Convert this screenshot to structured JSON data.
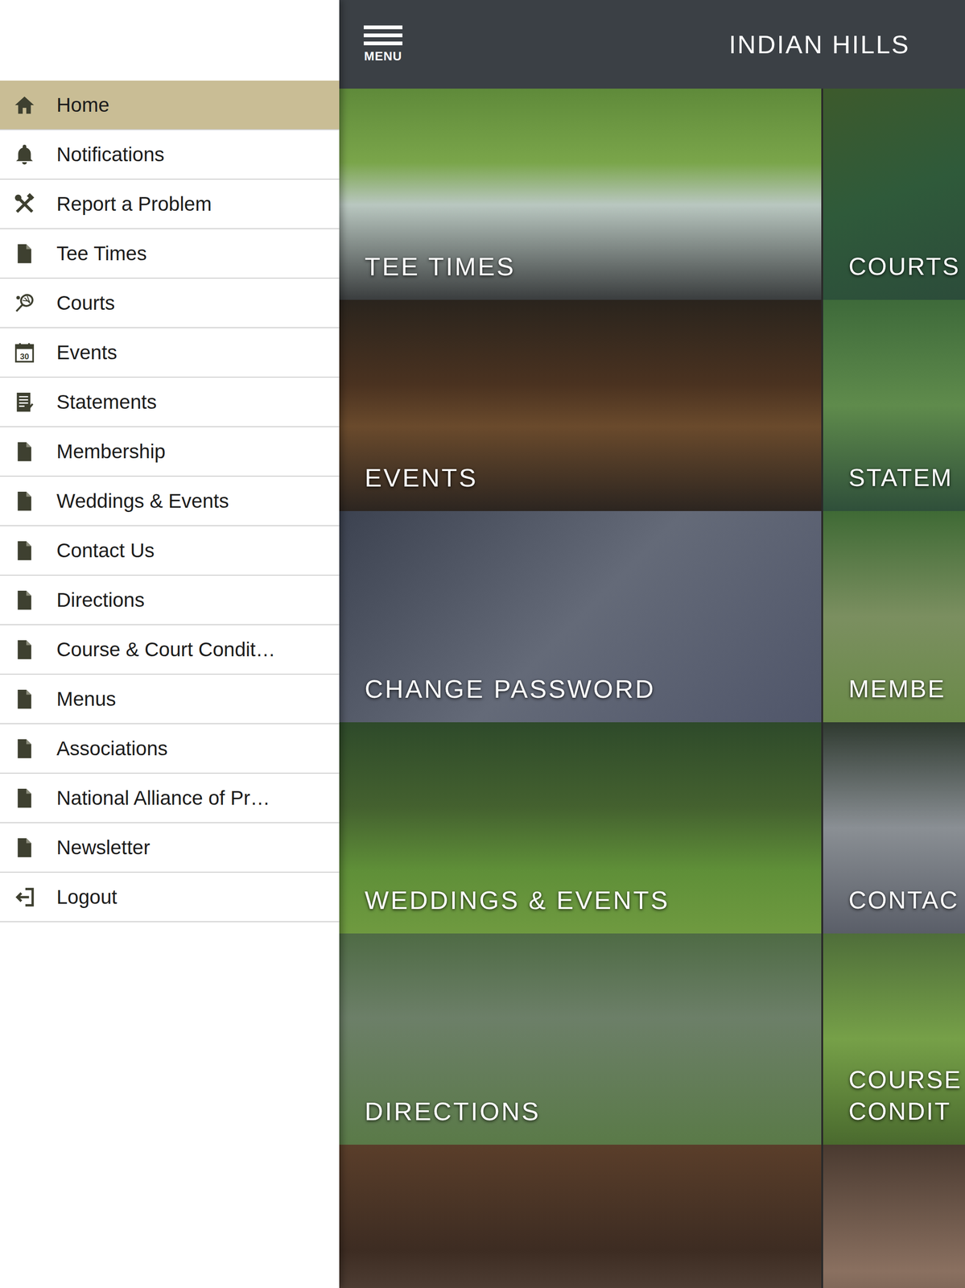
{
  "header": {
    "menu_label": "MENU",
    "title": "INDIAN HILLS"
  },
  "sidebar": {
    "items": [
      {
        "label": "Home",
        "kind": "home",
        "selected": true
      },
      {
        "label": "Notifications",
        "kind": "bell",
        "selected": false
      },
      {
        "label": "Report a Problem",
        "kind": "tools",
        "selected": false
      },
      {
        "label": "Tee Times",
        "kind": "doc",
        "selected": false
      },
      {
        "label": "Courts",
        "kind": "racket",
        "selected": false
      },
      {
        "label": "Events",
        "kind": "calendar",
        "icon_text": "30",
        "selected": false
      },
      {
        "label": "Statements",
        "kind": "statement",
        "selected": false
      },
      {
        "label": "Membership",
        "kind": "doc",
        "selected": false
      },
      {
        "label": "Weddings & Events",
        "kind": "doc",
        "selected": false
      },
      {
        "label": "Contact Us",
        "kind": "doc",
        "selected": false
      },
      {
        "label": "Directions",
        "kind": "doc",
        "selected": false
      },
      {
        "label": "Course & Court Condit…",
        "kind": "doc",
        "selected": false
      },
      {
        "label": "Menus",
        "kind": "doc",
        "selected": false
      },
      {
        "label": "Associations",
        "kind": "doc",
        "selected": false
      },
      {
        "label": "National Alliance of Pr…",
        "kind": "doc",
        "selected": false
      },
      {
        "label": "Newsletter",
        "kind": "doc",
        "selected": false
      },
      {
        "label": "Logout",
        "kind": "logout",
        "selected": false
      }
    ]
  },
  "tiles": [
    {
      "lines": [
        "TEE TIMES"
      ]
    },
    {
      "lines": [
        "COURTS"
      ]
    },
    {
      "lines": [
        "EVENTS"
      ]
    },
    {
      "lines": [
        "STATEM"
      ]
    },
    {
      "lines": [
        "CHANGE PASSWORD"
      ]
    },
    {
      "lines": [
        "MEMBE"
      ]
    },
    {
      "lines": [
        "WEDDINGS & EVENTS"
      ]
    },
    {
      "lines": [
        "CONTAC"
      ]
    },
    {
      "lines": [
        "DIRECTIONS"
      ]
    },
    {
      "lines": [
        "COURSE",
        "CONDIT"
      ]
    },
    {
      "lines": []
    },
    {
      "lines": []
    }
  ]
}
